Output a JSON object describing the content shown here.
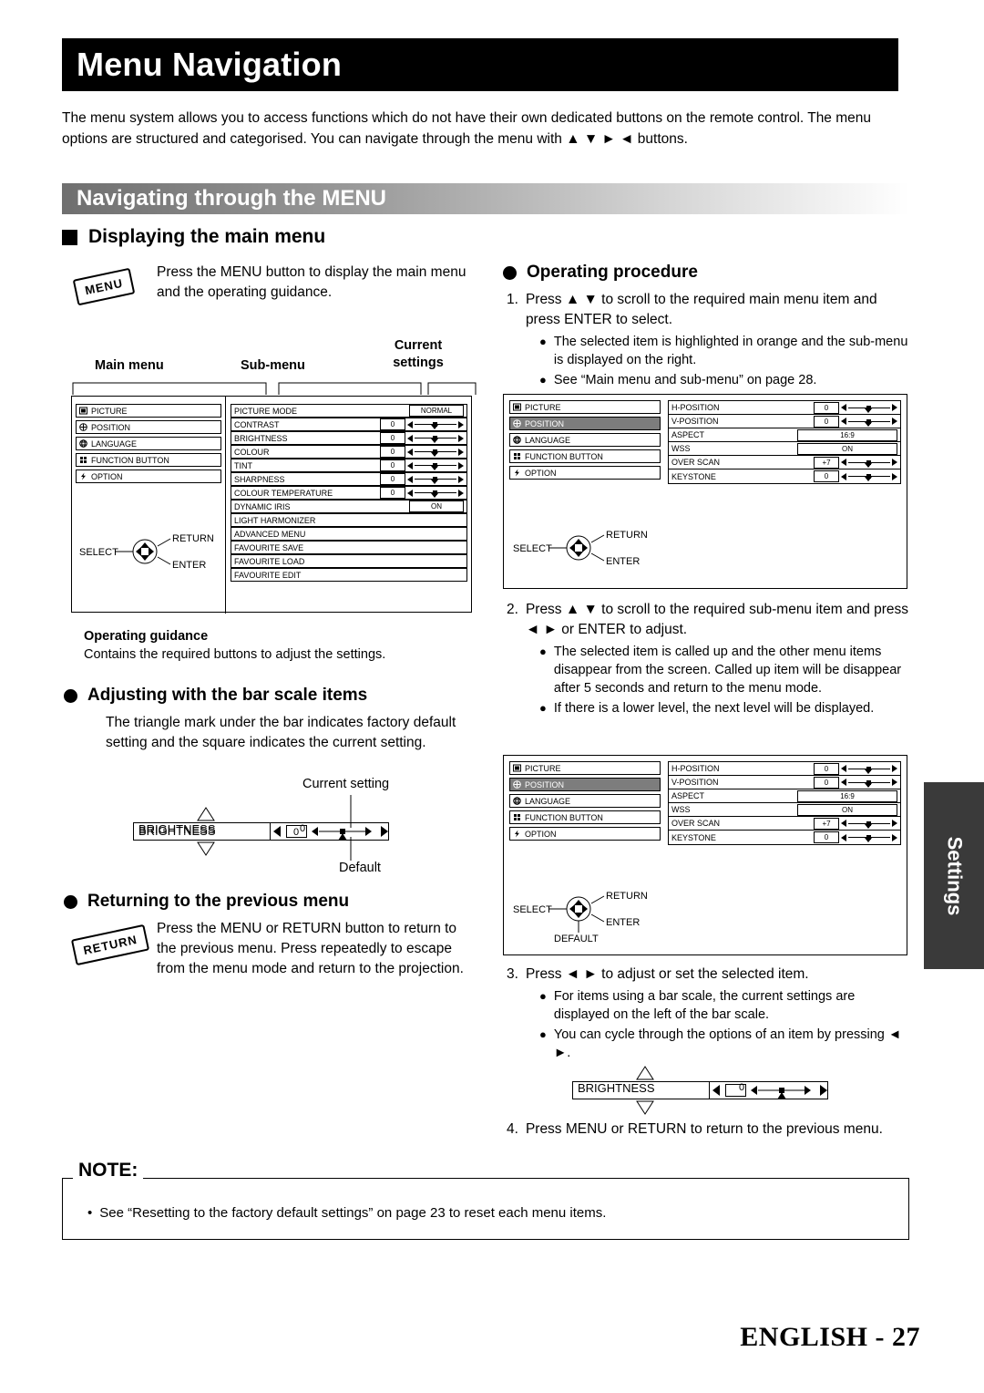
{
  "page": {
    "title": "Menu Navigation",
    "intro": "The menu system allows you to access functions which do not have their own dedicated buttons on the remote control. The menu options are structured and categorised. You can navigate through the menu with ▲ ▼ ► ◄ buttons.",
    "section_title": "Navigating through the MENU",
    "side_tab": "Settings",
    "footer_lang": "ENGLISH",
    "footer_sep": " - ",
    "footer_page": "27"
  },
  "display_main_menu": {
    "heading": "Displaying the main menu",
    "stamp": "MENU",
    "text": "Press the MENU button to display the main menu and the operating guidance.",
    "labels": {
      "main_menu": "Main menu",
      "sub_menu": "Sub-menu",
      "current_settings_l1": "Current",
      "current_settings_l2": "settings",
      "operating_guidance": "Operating guidance",
      "operating_guidance_desc": "Contains the required buttons to adjust the settings."
    },
    "main_menu_items": [
      {
        "icon": "picture-icon",
        "label": "PICTURE"
      },
      {
        "icon": "position-icon",
        "label": "POSITION"
      },
      {
        "icon": "language-icon",
        "label": "LANGUAGE"
      },
      {
        "icon": "function-button-icon",
        "label": "FUNCTION BUTTON"
      },
      {
        "icon": "option-icon",
        "label": "OPTION"
      }
    ],
    "sub_menu_items": [
      {
        "label": "PICTURE MODE",
        "value": "NORMAL",
        "type": "value"
      },
      {
        "label": "CONTRAST",
        "value": "0",
        "type": "bar"
      },
      {
        "label": "BRIGHTNESS",
        "value": "0",
        "type": "bar"
      },
      {
        "label": "COLOUR",
        "value": "0",
        "type": "bar"
      },
      {
        "label": "TINT",
        "value": "0",
        "type": "bar"
      },
      {
        "label": "SHARPNESS",
        "value": "0",
        "type": "bar"
      },
      {
        "label": "COLOUR TEMPERATURE",
        "value": "0",
        "type": "bar"
      },
      {
        "label": "DYNAMIC IRIS",
        "value": "ON",
        "type": "value"
      },
      {
        "label": "LIGHT HARMONIZER",
        "value": "",
        "type": "none"
      },
      {
        "label": "ADVANCED MENU",
        "value": "",
        "type": "none"
      },
      {
        "label": "FAVOURITE SAVE",
        "value": "",
        "type": "none"
      },
      {
        "label": "FAVOURITE LOAD",
        "value": "",
        "type": "none"
      },
      {
        "label": "FAVOURITE EDIT",
        "value": "",
        "type": "none"
      }
    ],
    "guidance": {
      "select": "SELECT",
      "return": "RETURN",
      "enter": "ENTER"
    }
  },
  "bar_scale": {
    "heading": "Adjusting with the bar scale items",
    "text": "The triangle mark under the bar indicates factory default setting and the square indicates the current setting.",
    "current_setting_label": "Current setting",
    "default_label": "Default",
    "item_label": "BRIGHTNESS",
    "item_value": "0"
  },
  "previous_menu": {
    "heading": "Returning to the previous menu",
    "stamp": "RETURN",
    "text": "Press the MENU or RETURN button to return to the previous menu. Press repeatedly to escape from the menu mode and return to the projection."
  },
  "operating_procedure": {
    "heading": "Operating procedure",
    "steps": [
      {
        "num": "1.",
        "text": "Press ▲ ▼ to scroll to the required main menu item and press ENTER to select.",
        "bullets": [
          "The selected item is highlighted in orange and the sub-menu is displayed on the right.",
          "See “Main menu and sub-menu” on page 28."
        ]
      },
      {
        "num": "2.",
        "text": "Press ▲ ▼ to scroll to the required sub-menu item and press ◄ ► or ENTER to adjust.",
        "bullets": [
          "The selected item is called up and the other menu items disappear from the screen. Called up item will be disappear after 5 seconds and return to the menu mode.",
          "If there is a lower level, the next level will be displayed."
        ]
      },
      {
        "num": "3.",
        "text": "Press ◄ ► to adjust or set the selected item.",
        "bullets": [
          "For items using a bar scale, the current settings are displayed on the left of the bar scale.",
          "You can cycle through the options of an item by pressing ◄ ►."
        ]
      },
      {
        "num": "4.",
        "text": "Press MENU or RETURN to return to the previous menu.",
        "bullets": []
      }
    ],
    "osd1": {
      "main_items": [
        {
          "icon": "picture-icon",
          "label": "PICTURE",
          "selected": false
        },
        {
          "icon": "position-icon",
          "label": "POSITION",
          "selected": true
        },
        {
          "icon": "language-icon",
          "label": "LANGUAGE",
          "selected": false
        },
        {
          "icon": "function-button-icon",
          "label": "FUNCTION BUTTON",
          "selected": false
        },
        {
          "icon": "option-icon",
          "label": "OPTION",
          "selected": false
        }
      ],
      "sub_items": [
        {
          "label": "H-POSITION",
          "value": "0",
          "type": "bar"
        },
        {
          "label": "V-POSITION",
          "value": "0",
          "type": "bar"
        },
        {
          "label": "ASPECT",
          "value": "16:9",
          "type": "value"
        },
        {
          "label": "WSS",
          "value": "ON",
          "type": "value"
        },
        {
          "label": "OVER SCAN",
          "value": "+7",
          "type": "bar"
        },
        {
          "label": "KEYSTONE",
          "value": "0",
          "type": "bar"
        }
      ],
      "guidance": {
        "select": "SELECT",
        "return": "RETURN",
        "enter": "ENTER"
      }
    },
    "osd2": {
      "main_items": [
        {
          "icon": "picture-icon",
          "label": "PICTURE",
          "selected": false
        },
        {
          "icon": "position-icon",
          "label": "POSITION",
          "selected": true
        },
        {
          "icon": "language-icon",
          "label": "LANGUAGE",
          "selected": false
        },
        {
          "icon": "function-button-icon",
          "label": "FUNCTION BUTTON",
          "selected": false
        },
        {
          "icon": "option-icon",
          "label": "OPTION",
          "selected": false
        }
      ],
      "sub_items": [
        {
          "label": "H-POSITION",
          "value": "0",
          "type": "bar"
        },
        {
          "label": "V-POSITION",
          "value": "0",
          "type": "bar"
        },
        {
          "label": "ASPECT",
          "value": "16:9",
          "type": "value"
        },
        {
          "label": "WSS",
          "value": "ON",
          "type": "value"
        },
        {
          "label": "OVER SCAN",
          "value": "+7",
          "type": "bar"
        },
        {
          "label": "KEYSTONE",
          "value": "0",
          "type": "bar"
        }
      ],
      "guidance": {
        "select": "SELECT",
        "return": "RETURN",
        "enter": "ENTER",
        "default": "DEFAULT"
      }
    },
    "bar_widget": {
      "label": "BRIGHTNESS",
      "value": "0"
    }
  },
  "note": {
    "label": "NOTE:",
    "text": "See “Resetting to the factory default settings” on page 23 to reset each menu items."
  }
}
